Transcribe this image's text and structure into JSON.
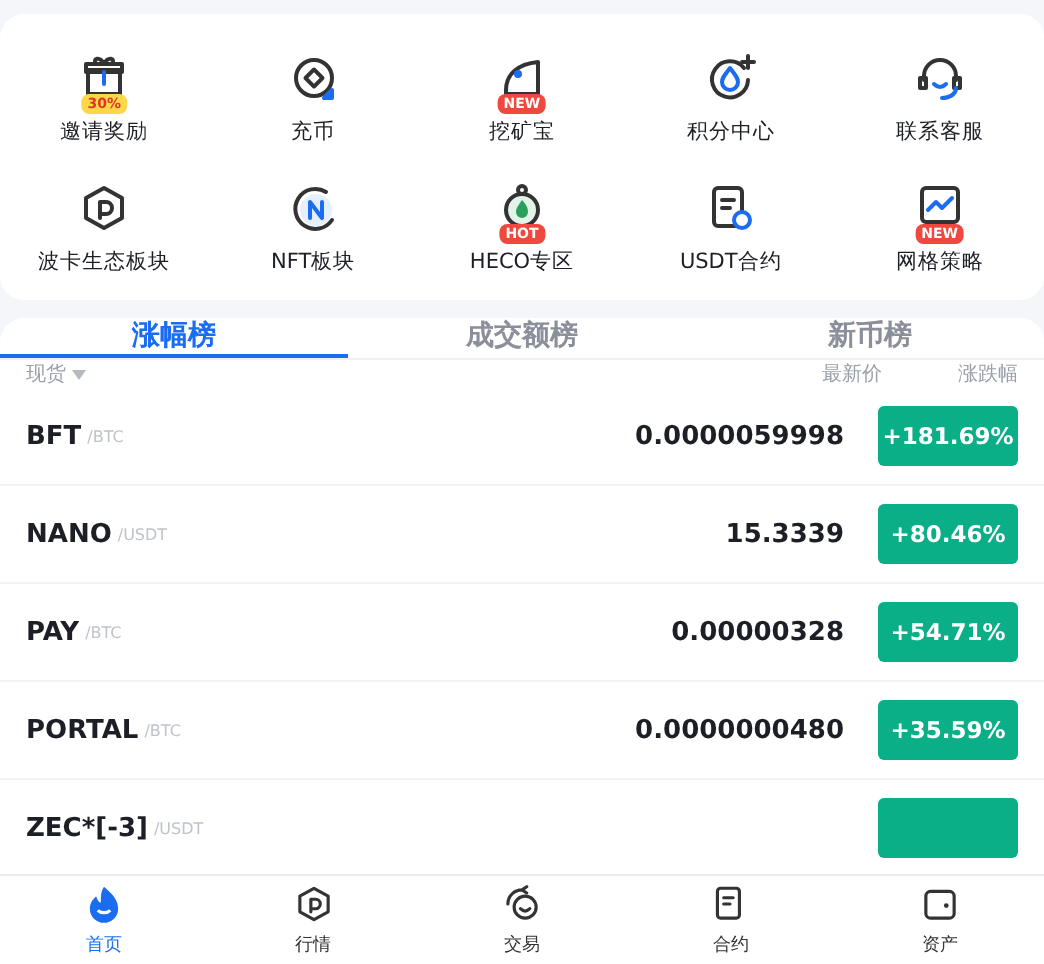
{
  "shortcuts": [
    {
      "label": "邀请奖励",
      "badge": "30%",
      "color": "#ffd84a"
    },
    {
      "label": "充币"
    },
    {
      "label": "挖矿宝",
      "badge": "NEW",
      "color": "#f0483e"
    },
    {
      "label": "积分中心"
    },
    {
      "label": "联系客服"
    },
    {
      "label": "波卡生态板块"
    },
    {
      "label": "NFT板块"
    },
    {
      "label": "HECO专区",
      "badge": "HOT",
      "color": "#f0483e"
    },
    {
      "label": "USDT合约"
    },
    {
      "label": "网格策略",
      "badge": "NEW",
      "color": "#f0483e"
    }
  ],
  "tabs": [
    {
      "label": "涨幅榜",
      "selected": true
    },
    {
      "label": "成交额榜",
      "selected": false
    },
    {
      "label": "新币榜",
      "selected": false
    }
  ],
  "table_header": {
    "market": "现货",
    "price": "最新价",
    "change": "涨跌幅"
  },
  "rows": [
    {
      "symbol": "BFT",
      "pair": "/BTC",
      "price": "0.0000059998",
      "change": "+181.69%"
    },
    {
      "symbol": "NANO",
      "pair": "/USDT",
      "price": "15.3339",
      "change": "+80.46%"
    },
    {
      "symbol": "PAY",
      "pair": "/BTC",
      "price": "0.00000328",
      "change": "+54.71%"
    },
    {
      "symbol": "PORTAL",
      "pair": "/BTC",
      "price": "0.0000000480",
      "change": "+35.59%"
    },
    {
      "symbol": "ZEC*[-3]",
      "pair": "/USDT"
    }
  ],
  "bottom_nav": [
    {
      "label": "首页",
      "selected": true
    },
    {
      "label": "行情",
      "selected": false
    },
    {
      "label": "交易",
      "selected": false
    },
    {
      "label": "合约",
      "selected": false
    },
    {
      "label": "资产",
      "selected": false
    }
  ]
}
